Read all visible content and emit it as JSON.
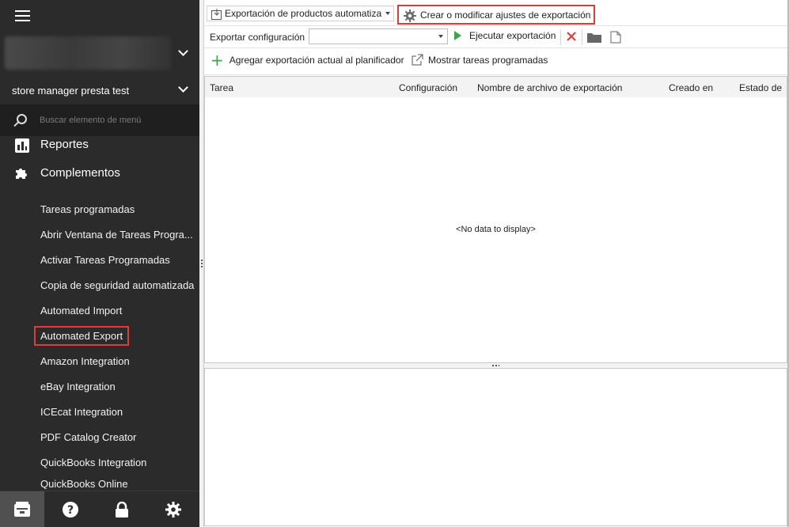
{
  "sidebar": {
    "store_name": "store manager presta test",
    "search_placeholder": "Buscar elemento de menú",
    "sections": [
      {
        "label": "Reportes",
        "icon": "bar-chart-icon"
      },
      {
        "label": "Complementos",
        "icon": "puzzle-icon"
      }
    ],
    "sub_items": [
      "Tareas programadas",
      "Abrir Ventana de Tareas Progra...",
      "Activar Tareas Programadas",
      "Copia de seguridad automatizada",
      "Automated Import",
      "Automated Export",
      "Amazon Integration",
      "eBay Integration",
      "ICEcat Integration",
      "PDF Catalog Creator",
      "QuickBooks Integration",
      "QuickBooks Online"
    ],
    "bottom_icons": [
      "store-icon",
      "help-icon",
      "lock-icon",
      "gear-icon"
    ]
  },
  "toolbar": {
    "export_type": "Exportación de productos automatiza",
    "settings_label": "Crear o modificar ajustes de exportación",
    "config_label": "Exportar configuración",
    "config_value": "",
    "run_label": "Ejecutar exportación",
    "add_label": "Agregar exportación actual al planificador",
    "show_label": "Mostrar tareas programadas"
  },
  "grid": {
    "columns": [
      "Tarea",
      "Configuración",
      "Nombre de archivo de exportación",
      "Creado en",
      "Estado de"
    ],
    "empty_text": "<No data to display>"
  },
  "colors": {
    "sidebar_bg": "#2b2b2b",
    "highlight": "#e53935",
    "run_green": "#3aa64a",
    "delete_red": "#e53935"
  }
}
